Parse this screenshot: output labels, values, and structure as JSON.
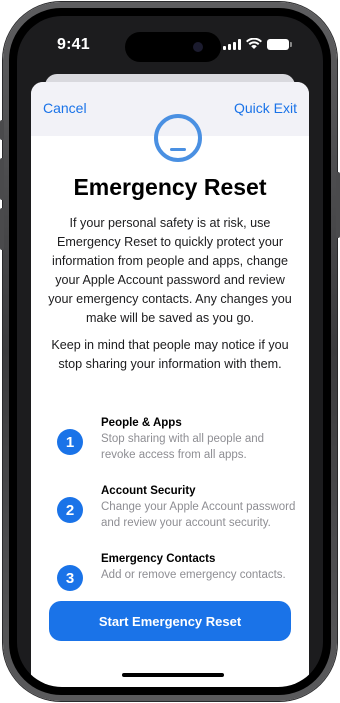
{
  "status_bar": {
    "time": "9:41"
  },
  "nav": {
    "cancel_label": "Cancel",
    "quick_exit_label": "Quick Exit"
  },
  "page": {
    "title": "Emergency Reset",
    "intro": "If your personal safety is at risk, use Emergency Reset to quickly protect your information from people and apps, change your Apple Account password and review your emergency contacts. Any changes you make will be saved as you go.",
    "note": "Keep in mind that people may notice if you stop sharing your information with them."
  },
  "steps": [
    {
      "number": "1",
      "title": "People & Apps",
      "description": "Stop sharing with all people and revoke access from all apps."
    },
    {
      "number": "2",
      "title": "Account Security",
      "description": "Change your Apple Account password and review your account security."
    },
    {
      "number": "3",
      "title": "Emergency Contacts",
      "description": "Add or remove emergency contacts."
    }
  ],
  "cta": {
    "label": "Start Emergency Reset"
  },
  "colors": {
    "accent": "#1a73e8",
    "secondary_text": "#8e8e93"
  },
  "icons": {
    "status": [
      "signal-icon",
      "wifi-icon",
      "battery-icon"
    ],
    "hero": "emergency-reset-icon"
  }
}
